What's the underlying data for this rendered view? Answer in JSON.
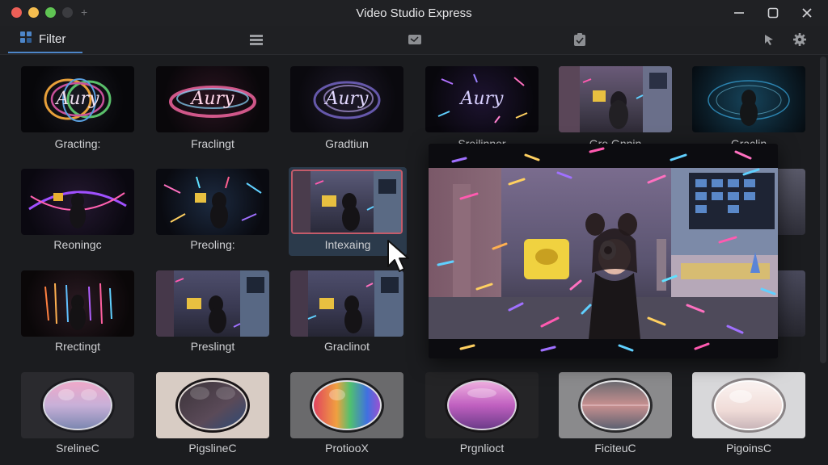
{
  "window": {
    "title": "Video Studio Express"
  },
  "toolbar": {
    "filter_label": "Filter",
    "icons": [
      "grid-icon",
      "list-icon",
      "image-icon",
      "clipboard-icon",
      "cursor-icon",
      "gear-icon"
    ]
  },
  "filters": {
    "row1": [
      "Gracting:",
      "Fraclingt",
      "Gradtiun",
      "Sreilinner",
      "Gro.Gnnin",
      "Graclin"
    ],
    "row2": [
      "Reoningc",
      "Preoling:",
      "Intexaing",
      "",
      "",
      ""
    ],
    "row3": [
      "Rrectingt",
      "Preslingt",
      "Graclinot",
      "",
      "",
      ""
    ],
    "row4": [
      "SrelineC",
      "PigslineC",
      "ProtiooX",
      "Prgnlioct",
      "FiciteuC",
      "PigoinsC"
    ]
  },
  "selected_filter": "Intexaing",
  "thumb_text": "Aury"
}
